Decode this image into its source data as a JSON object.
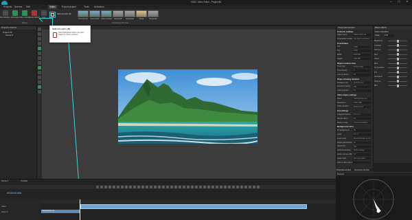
{
  "window": {
    "title": "VSDC Video Editor - Project 56",
    "minimize_glyph": "–",
    "maximize_glyph": "□",
    "close_glyph": "×"
  },
  "menu": {
    "tabs": [
      "Projects",
      "Scenes",
      "Edit",
      "Video",
      "Export project",
      "Tools",
      "Activation"
    ],
    "active": "Video"
  },
  "ribbon": {
    "buttons": [
      {
        "label": "Run Wizard...",
        "icon": "wizard-icon"
      },
      {
        "label": "Add object",
        "icon": "add-object-icon"
      },
      {
        "label": "Video effects",
        "icon": "video-effects-icon"
      },
      {
        "label": "Audio effects",
        "icon": "audio-effects-icon"
      },
      {
        "label": "Cut",
        "icon": "cut-icon"
      }
    ],
    "group_labels": [
      "Editing",
      "Choosing quick style"
    ],
    "split_button_label": "Split into parts (B)",
    "styles": [
      "Remove all",
      "Auto levels",
      "Auto contrast",
      "Grayscale",
      "Grayscale",
      "Sepia",
      "Grayscale"
    ]
  },
  "tooltip": {
    "title": "Split into parts (B)",
    "description": "Split highlighted object into parts based on cursor position"
  },
  "left_panel": {
    "title": "Projects explorer",
    "tree": [
      "Project 56",
      "Scene 0"
    ]
  },
  "properties": {
    "title": "Properties window",
    "common_settings": "Common settings",
    "rows": [
      {
        "key": "Object name",
        "value": "Islands photo_04"
      },
      {
        "key": "Composition mode",
        "value": "Use layer's properties"
      },
      {
        "key": "Coordinates",
        "value": "",
        "section": true
      },
      {
        "key": "Left",
        "value": "0,000"
      },
      {
        "key": "Top",
        "value": "0,000"
      },
      {
        "key": "Width",
        "value": "1920,000"
      },
      {
        "key": "Height",
        "value": "1080,000"
      },
      {
        "key": "Object creation time",
        "value": "",
        "section": true
      },
      {
        "key": "Time (ms)",
        "value": "00:00:00.000"
      },
      {
        "key": "Time (frame)",
        "value": "0"
      },
      {
        "key": "Lock to parent",
        "value": "No"
      },
      {
        "key": "Object drawing duration",
        "value": "",
        "section": true
      },
      {
        "key": "Duration (ms)",
        "value": "00:00:31.131"
      },
      {
        "key": "Duration (frame)",
        "value": "933"
      },
      {
        "key": "Lock to parent",
        "value": "No"
      },
      {
        "key": "Video object settings",
        "value": "",
        "section": true
      },
      {
        "key": "Video",
        "value": "Islands photo.mp4"
      },
      {
        "key": "Resolution",
        "value": "1920; 1080"
      },
      {
        "key": "Video duration",
        "value": "00:00:31.131"
      },
      {
        "key": "Cut settings",
        "value": "",
        "section": true
      },
      {
        "key": "Cropped borders",
        "value": "0; 0; 0; 0"
      },
      {
        "key": "Stretch video",
        "value": "No"
      },
      {
        "key": "Resize mode",
        "value": "Linear interpolation"
      },
      {
        "key": "Background color",
        "value": "",
        "section": true
      },
      {
        "key": "Fill background",
        "value": "No"
      },
      {
        "key": "Color",
        "value": "0; 0; 0"
      },
      {
        "key": "Loop mode",
        "value": "Show last frame at end"
      },
      {
        "key": "Playing backwards",
        "value": "No"
      },
      {
        "key": "Speed (%)",
        "value": "100"
      },
      {
        "key": "Sound stretching",
        "value": "Tempo change"
      },
      {
        "key": "Audio volume (dB)",
        "value": "0,0"
      },
      {
        "key": "Audio track",
        "value": "Don't use audio"
      },
      {
        "key": "Split to video and audio",
        "value": ""
      }
    ],
    "tabs": [
      "Properties window",
      "Resources window"
    ]
  },
  "effects": {
    "title": "Basic effects",
    "toggle": "Color correction",
    "angle_label": "Angle",
    "angle_value": "0,00",
    "sliders": [
      {
        "label": "Brightness",
        "pos": 0.5
      },
      {
        "label": "Contrast",
        "pos": 0.5
      },
      {
        "label": "Gamma",
        "pos": 0.5
      },
      {
        "label": "Red",
        "pos": 0.5
      },
      {
        "label": "Green",
        "pos": 0.5
      },
      {
        "label": "Blue",
        "pos": 0.5
      },
      {
        "label": "Temperature",
        "pos": 0.5
      },
      {
        "label": "Tint",
        "pos": 0.5
      },
      {
        "label": "Saturation",
        "pos": 0.5
      },
      {
        "label": "Sharpen",
        "pos": 0.5
      },
      {
        "label": "Blur",
        "pos": 0.5
      }
    ]
  },
  "scopes": {
    "title": "Scopes"
  },
  "timeline": {
    "timecode": "00:00:00.000",
    "tracks": [
      "Video",
      "Layer 1"
    ],
    "clip_label": "Islands photo_04",
    "tabs": [
      "Scene 0",
      "Timeline"
    ]
  }
}
